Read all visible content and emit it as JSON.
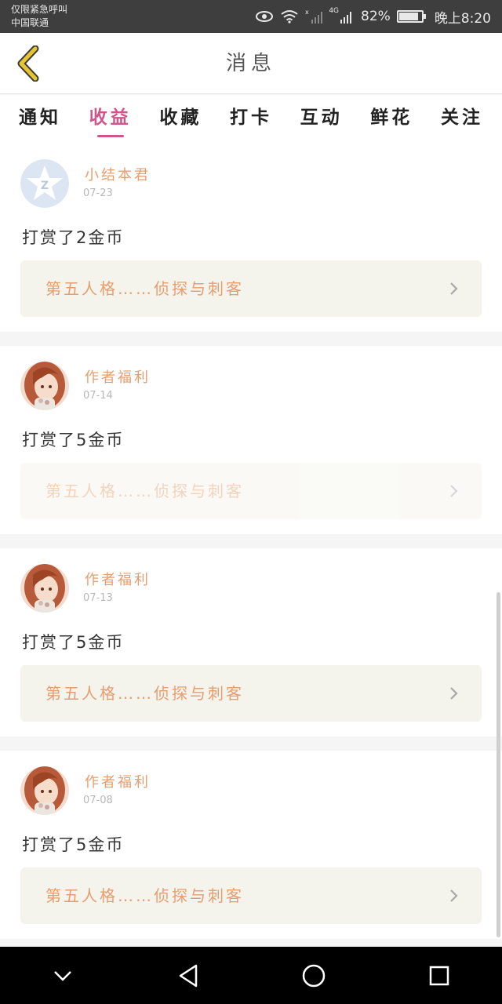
{
  "status_bar": {
    "carrier_line1": "仅限紧急呼叫",
    "carrier_line2": "中国联通",
    "network": "4G",
    "battery": "82%",
    "battery_level": 0.82,
    "time": "晚上8:20"
  },
  "header": {
    "title": "消息",
    "back_icon": "chevron-left-icon"
  },
  "tabs": [
    {
      "label": "通知",
      "active": false
    },
    {
      "label": "收益",
      "active": true
    },
    {
      "label": "收藏",
      "active": false
    },
    {
      "label": "打卡",
      "active": false
    },
    {
      "label": "互动",
      "active": false
    },
    {
      "label": "鲜花",
      "active": false
    },
    {
      "label": "关注",
      "active": false
    }
  ],
  "messages": [
    {
      "user": "小结本君",
      "date": "07-23",
      "text": "打赏了2金币",
      "work": "第五人格……侦探与刺客",
      "faded": false,
      "avatar": "default-avatar"
    },
    {
      "user": "作者福利",
      "date": "07-14",
      "text": "打赏了5金币",
      "work": "第五人格……侦探与刺客",
      "faded": true,
      "avatar": "anime-avatar"
    },
    {
      "user": "作者福利",
      "date": "07-13",
      "text": "打赏了5金币",
      "work": "第五人格……侦探与刺客",
      "faded": false,
      "avatar": "anime-avatar"
    },
    {
      "user": "作者福利",
      "date": "07-08",
      "text": "打赏了5金币",
      "work": "第五人格……侦探与刺客",
      "faded": false,
      "avatar": "anime-avatar"
    }
  ],
  "colors": {
    "accent_pink": "#d0558a",
    "name_orange": "#e79e6f",
    "back_yellow": "#e6c531"
  }
}
